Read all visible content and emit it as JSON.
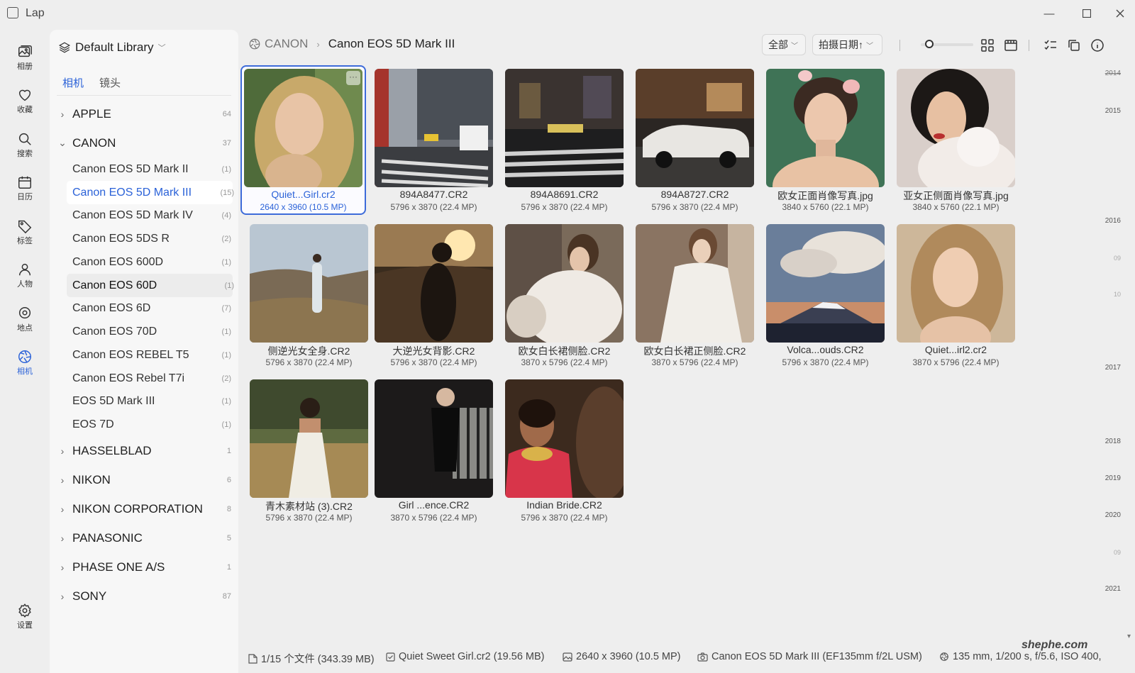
{
  "app": {
    "title": "Lap"
  },
  "rail": [
    {
      "label": "相册",
      "icon": "photo-album-icon"
    },
    {
      "label": "收藏",
      "icon": "heart-icon"
    },
    {
      "label": "搜索",
      "icon": "search-icon"
    },
    {
      "label": "日历",
      "icon": "calendar-icon"
    },
    {
      "label": "标签",
      "icon": "tag-icon"
    },
    {
      "label": "人物",
      "icon": "person-icon"
    },
    {
      "label": "地点",
      "icon": "location-pin-icon"
    },
    {
      "label": "相机",
      "icon": "aperture-icon"
    },
    {
      "label": "设置",
      "icon": "gear-icon"
    }
  ],
  "sidebar": {
    "library": "Default Library",
    "tabs": [
      "相机",
      "镜头"
    ],
    "tree": [
      {
        "label": "APPLE",
        "count": "64"
      },
      {
        "label": "CANON",
        "count": "37"
      },
      {
        "label": "Canon EOS 5D Mark II",
        "count": "(1)"
      },
      {
        "label": "Canon EOS 5D Mark III",
        "count": "(15)"
      },
      {
        "label": "Canon EOS 5D Mark IV",
        "count": "(4)"
      },
      {
        "label": "Canon EOS 5DS R",
        "count": "(2)"
      },
      {
        "label": "Canon EOS 600D",
        "count": "(1)"
      },
      {
        "label": "Canon EOS 60D",
        "count": "(1)"
      },
      {
        "label": "Canon EOS 6D",
        "count": "(7)"
      },
      {
        "label": "Canon EOS 70D",
        "count": "(1)"
      },
      {
        "label": "Canon EOS REBEL T5",
        "count": "(1)"
      },
      {
        "label": "Canon EOS Rebel T7i",
        "count": "(2)"
      },
      {
        "label": "EOS 5D Mark III",
        "count": "(1)"
      },
      {
        "label": "EOS 7D",
        "count": "(1)"
      },
      {
        "label": "HASSELBLAD",
        "count": "1"
      },
      {
        "label": "NIKON",
        "count": "6"
      },
      {
        "label": "NIKON CORPORATION",
        "count": "8"
      },
      {
        "label": "PANASONIC",
        "count": "5"
      },
      {
        "label": "PHASE ONE A/S",
        "count": "1"
      },
      {
        "label": "SONY",
        "count": "87"
      }
    ]
  },
  "toolbar": {
    "breadcrumb_root": "CANON",
    "breadcrumb_current": "Canon EOS 5D Mark III",
    "filter_label": "全部",
    "sort_label": "拍摄日期↑",
    "zoom_level": 0.1
  },
  "photos": [
    {
      "name": "Quiet...Girl.cr2",
      "dims": "2640 x 3960 (10.5 MP)"
    },
    {
      "name": "894A8477.CR2",
      "dims": "5796 x 3870 (22.4 MP)"
    },
    {
      "name": "894A8691.CR2",
      "dims": "5796 x 3870 (22.4 MP)"
    },
    {
      "name": "894A8727.CR2",
      "dims": "5796 x 3870 (22.4 MP)"
    },
    {
      "name": "欧女正面肖像写真.jpg",
      "dims": "3840 x 5760 (22.1 MP)"
    },
    {
      "name": "亚女正侧面肖像写真.jpg",
      "dims": "3840 x 5760 (22.1 MP)"
    },
    {
      "name": "侧逆光女全身.CR2",
      "dims": "5796 x 3870 (22.4 MP)"
    },
    {
      "name": "大逆光女背影.CR2",
      "dims": "5796 x 3870 (22.4 MP)"
    },
    {
      "name": "欧女白长裙侧脸.CR2",
      "dims": "3870 x 5796 (22.4 MP)"
    },
    {
      "name": "欧女白长裙正侧脸.CR2",
      "dims": "3870 x 5796 (22.4 MP)"
    },
    {
      "name": "Volca...ouds.CR2",
      "dims": "5796 x 3870 (22.4 MP)"
    },
    {
      "name": "Quiet...irl2.cr2",
      "dims": "3870 x 5796 (22.4 MP)"
    },
    {
      "name": "青木素材站 (3).CR2",
      "dims": "5796 x 3870 (22.4 MP)"
    },
    {
      "name": "Girl ...ence.CR2",
      "dims": "3870 x 5796 (22.4 MP)"
    },
    {
      "name": "Indian Bride.CR2",
      "dims": "5796 x 3870 (22.4 MP)"
    }
  ],
  "timeline": [
    {
      "label": "2014"
    },
    {
      "label": "2015"
    },
    {
      "label": "2016"
    },
    {
      "label": "09"
    },
    {
      "label": "10"
    },
    {
      "label": "2017"
    },
    {
      "label": "2018"
    },
    {
      "label": "2019"
    },
    {
      "label": "2020"
    },
    {
      "label": "09"
    },
    {
      "label": "2021"
    }
  ],
  "watermark": "shephe.com",
  "status": {
    "files": "1/15 个文件 (343.39 MB)",
    "selected": "Quiet Sweet Girl.cr2 (19.56 MB)",
    "resolution": "2640 x 3960 (10.5 MP)",
    "camera": "Canon EOS 5D Mark III (EF135mm f/2L USM)",
    "exif": "135 mm, 1/200 s, f/5.6, ISO 400,"
  }
}
